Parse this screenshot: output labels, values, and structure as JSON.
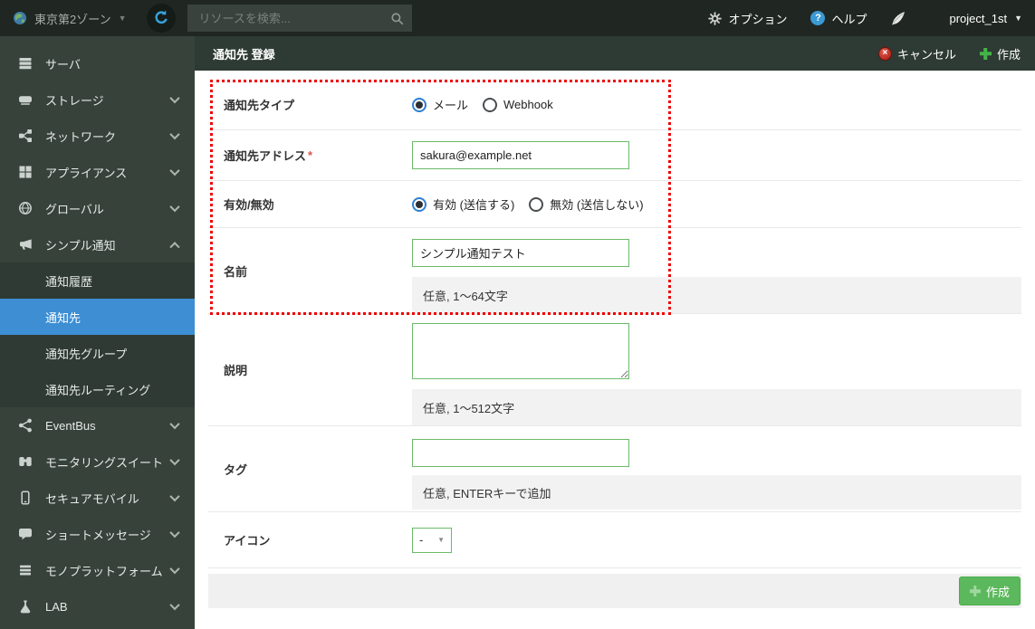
{
  "topbar": {
    "zone_label": "東京第2ゾーン",
    "search_placeholder": "リソースを検索...",
    "options_label": "オプション",
    "help_label": "ヘルプ",
    "project_label": "project_1st"
  },
  "sidebar": {
    "items": [
      {
        "label": "サーバ",
        "icon": "server-icon"
      },
      {
        "label": "ストレージ",
        "icon": "storage-icon"
      },
      {
        "label": "ネットワーク",
        "icon": "network-icon"
      },
      {
        "label": "アプライアンス",
        "icon": "appliance-icon"
      },
      {
        "label": "グローバル",
        "icon": "globe-icon"
      },
      {
        "label": "シンプル通知",
        "icon": "megaphone-icon",
        "expanded": true
      }
    ],
    "submenu": [
      {
        "label": "通知履歴",
        "selected": false
      },
      {
        "label": "通知先",
        "selected": true
      },
      {
        "label": "通知先グループ",
        "selected": false
      },
      {
        "label": "通知先ルーティング",
        "selected": false
      }
    ],
    "lower": [
      {
        "label": "EventBus",
        "icon": "share-icon"
      },
      {
        "label": "モニタリングスイート",
        "icon": "binoculars-icon"
      },
      {
        "label": "セキュアモバイル",
        "icon": "mobile-icon"
      },
      {
        "label": "ショートメッセージ",
        "icon": "chat-icon"
      },
      {
        "label": "モノプラットフォーム",
        "icon": "bars-icon"
      },
      {
        "label": "LAB",
        "icon": "flask-icon"
      }
    ]
  },
  "header": {
    "title": "通知先 登録",
    "cancel_label": "キャンセル",
    "create_label": "作成"
  },
  "form": {
    "type": {
      "label": "通知先タイプ",
      "options": [
        {
          "label": "メール",
          "selected": true
        },
        {
          "label": "Webhook",
          "selected": false
        }
      ]
    },
    "address": {
      "label": "通知先アドレス",
      "required_mark": "*",
      "value": "sakura@example.net"
    },
    "enabled": {
      "label": "有効/無効",
      "options": [
        {
          "label": "有効 (送信する)",
          "selected": true
        },
        {
          "label": "無効 (送信しない)",
          "selected": false
        }
      ]
    },
    "name": {
      "label": "名前",
      "value": "シンプル通知テスト",
      "help": "任意, 1〜64文字"
    },
    "description": {
      "label": "説明",
      "value": "",
      "help": "任意, 1〜512文字"
    },
    "tags": {
      "label": "タグ",
      "value": "",
      "help": "任意, ENTERキーで追加"
    },
    "icon": {
      "label": "アイコン",
      "value": "-"
    },
    "submit_label": "作成"
  },
  "colors": {
    "selected_blue": "#3d8ed3",
    "accent_green": "#5cb85c",
    "input_border_green": "#6abb69",
    "highlight_red": "#ee0000",
    "sidebar_bg": "#37423b",
    "topbar_bg": "#202723"
  }
}
